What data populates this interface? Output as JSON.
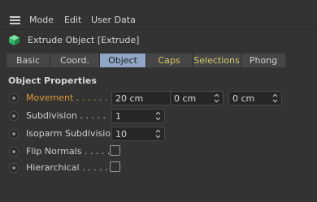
{
  "menu": {
    "items": [
      "Mode",
      "Edit",
      "User Data"
    ]
  },
  "object": {
    "title": "Extrude Object [Extrude]"
  },
  "tabs": [
    {
      "label": "Basic",
      "active": false,
      "highlight": false
    },
    {
      "label": "Coord.",
      "active": false,
      "highlight": false
    },
    {
      "label": "Object",
      "active": true,
      "highlight": false
    },
    {
      "label": "Caps",
      "active": false,
      "highlight": true
    },
    {
      "label": "Selections",
      "active": false,
      "highlight": true
    },
    {
      "label": "Phong",
      "active": false,
      "highlight": false
    }
  ],
  "section": {
    "title": "Object Properties"
  },
  "properties": {
    "movement": {
      "label": "Movement . . . . . .",
      "values": [
        "20 cm",
        "0 cm",
        "0 cm"
      ]
    },
    "subdivision": {
      "label": "Subdivision . . . . .",
      "value": "1"
    },
    "isoparm": {
      "label": "Isoparm Subdivision",
      "value": "10"
    },
    "flip_normals": {
      "label": "Flip Normals . . . . .",
      "checked": false
    },
    "hierarchical": {
      "label": "Hierarchical . . . . . .",
      "checked": false
    }
  },
  "colors": {
    "background": "#333333",
    "active_tab": "#91a6c7",
    "animated_label": "#e29a3c",
    "tab_highlight_text": "#d6c86a",
    "object_icon": "#3fd17a"
  }
}
